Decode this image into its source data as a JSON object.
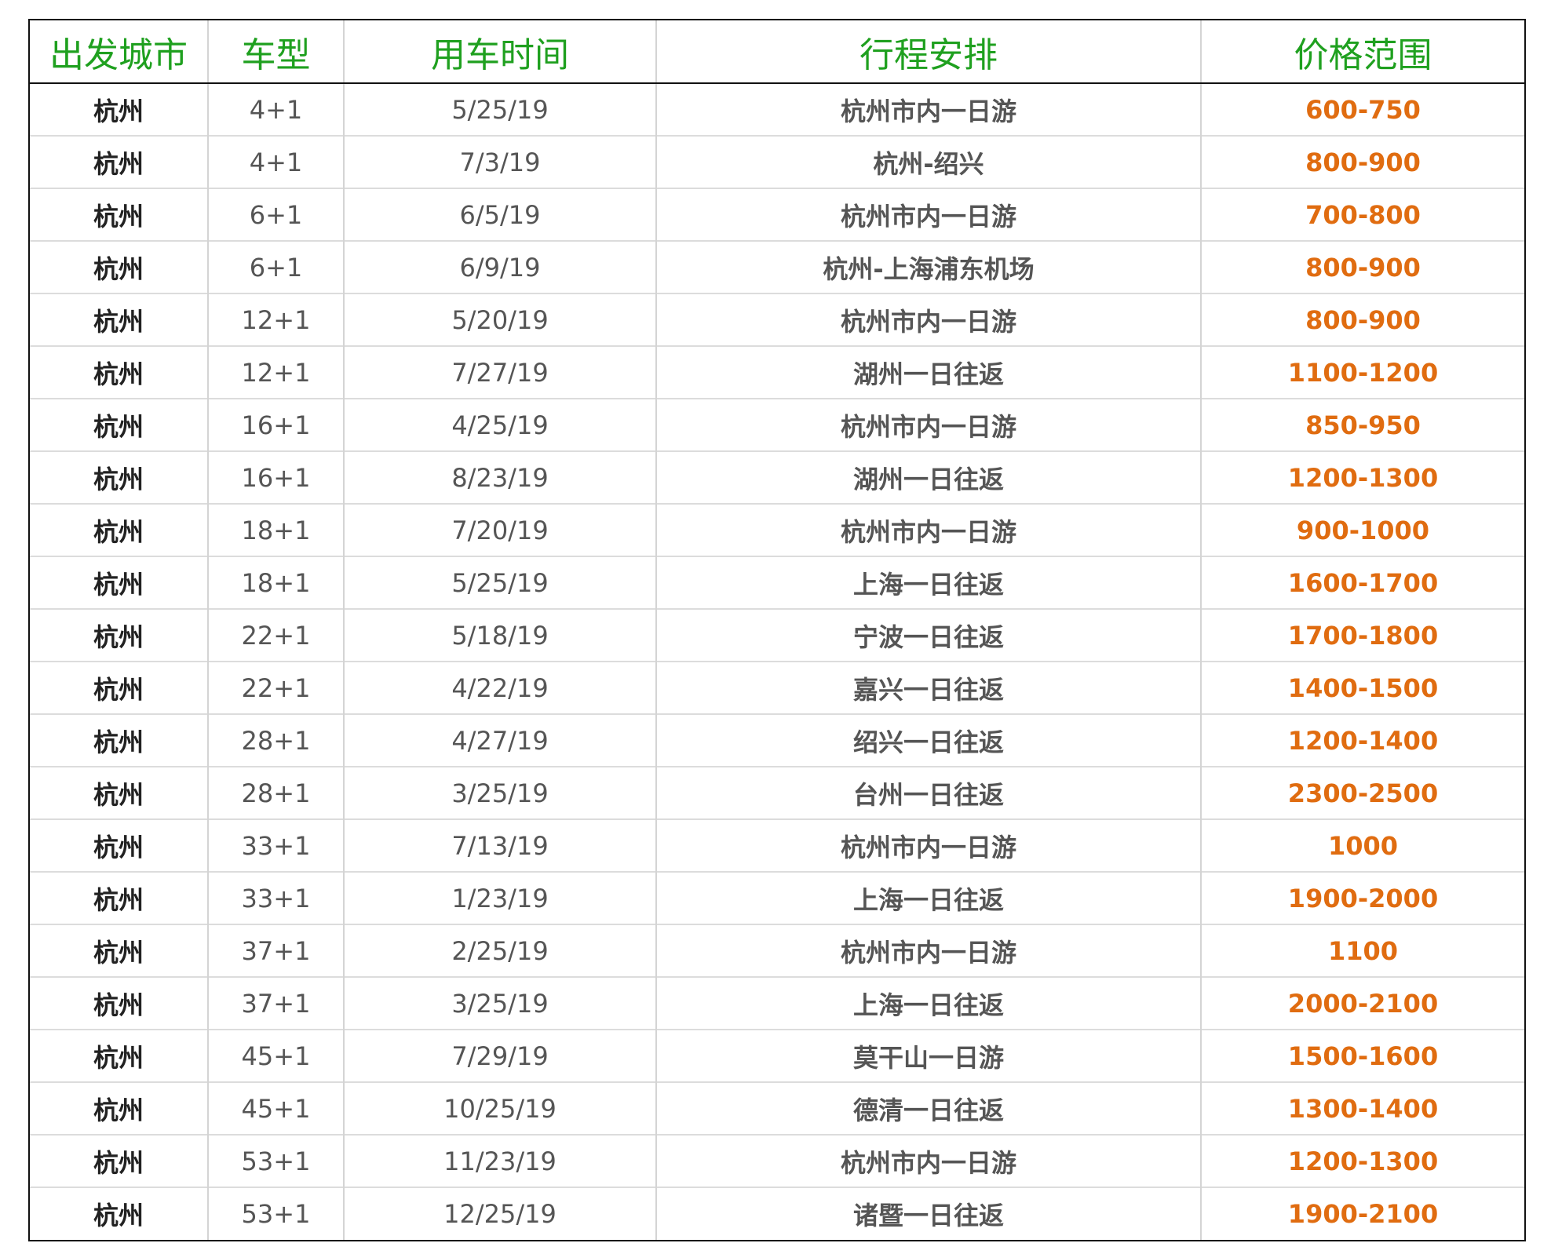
{
  "colors": {
    "header_text": "#1fa01f",
    "price_text": "#e06c10",
    "border": "#111111"
  },
  "table": {
    "headers": [
      "出发城市",
      "车型",
      "用车时间",
      "行程安排",
      "价格范围"
    ],
    "rows": [
      [
        "杭州",
        "4+1",
        "5/25/19",
        "杭州市内一日游",
        "600-750"
      ],
      [
        "杭州",
        "4+1",
        "7/3/19",
        "杭州-绍兴",
        "800-900"
      ],
      [
        "杭州",
        "6+1",
        "6/5/19",
        "杭州市内一日游",
        "700-800"
      ],
      [
        "杭州",
        "6+1",
        "6/9/19",
        "杭州-上海浦东机场",
        "800-900"
      ],
      [
        "杭州",
        "12+1",
        "5/20/19",
        "杭州市内一日游",
        "800-900"
      ],
      [
        "杭州",
        "12+1",
        "7/27/19",
        "湖州一日往返",
        "1100-1200"
      ],
      [
        "杭州",
        "16+1",
        "4/25/19",
        "杭州市内一日游",
        "850-950"
      ],
      [
        "杭州",
        "16+1",
        "8/23/19",
        "湖州一日往返",
        "1200-1300"
      ],
      [
        "杭州",
        "18+1",
        "7/20/19",
        "杭州市内一日游",
        "900-1000"
      ],
      [
        "杭州",
        "18+1",
        "5/25/19",
        "上海一日往返",
        "1600-1700"
      ],
      [
        "杭州",
        "22+1",
        "5/18/19",
        "宁波一日往返",
        "1700-1800"
      ],
      [
        "杭州",
        "22+1",
        "4/22/19",
        "嘉兴一日往返",
        "1400-1500"
      ],
      [
        "杭州",
        "28+1",
        "4/27/19",
        "绍兴一日往返",
        "1200-1400"
      ],
      [
        "杭州",
        "28+1",
        "3/25/19",
        "台州一日往返",
        "2300-2500"
      ],
      [
        "杭州",
        "33+1",
        "7/13/19",
        "杭州市内一日游",
        "1000"
      ],
      [
        "杭州",
        "33+1",
        "1/23/19",
        "上海一日往返",
        "1900-2000"
      ],
      [
        "杭州",
        "37+1",
        "2/25/19",
        "杭州市内一日游",
        "1100"
      ],
      [
        "杭州",
        "37+1",
        "3/25/19",
        "上海一日往返",
        "2000-2100"
      ],
      [
        "杭州",
        "45+1",
        "7/29/19",
        "莫干山一日游",
        "1500-1600"
      ],
      [
        "杭州",
        "45+1",
        "10/25/19",
        "德清一日往返",
        "1300-1400"
      ],
      [
        "杭州",
        "53+1",
        "11/23/19",
        "杭州市内一日游",
        "1200-1300"
      ],
      [
        "杭州",
        "53+1",
        "12/25/19",
        "诸暨一日往返",
        "1900-2100"
      ]
    ]
  }
}
